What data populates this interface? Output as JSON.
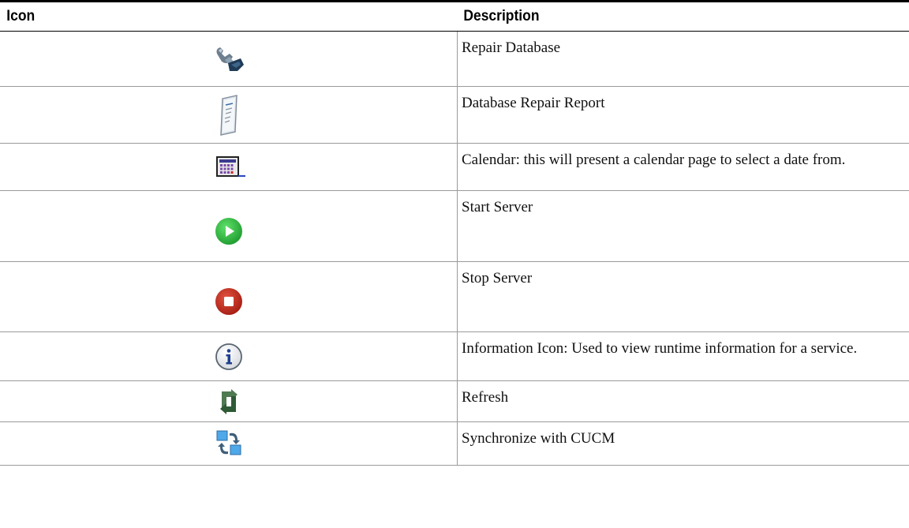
{
  "table": {
    "header": {
      "icon": "Icon",
      "description": "Description"
    },
    "rows": [
      {
        "icon": "repair-database-icon",
        "description": "Repair Database"
      },
      {
        "icon": "database-repair-report-icon",
        "description": "Database Repair Report"
      },
      {
        "icon": "calendar-icon",
        "description": "Calendar: this will present a calendar page to select a date from."
      },
      {
        "icon": "start-server-icon",
        "description": "Start Server"
      },
      {
        "icon": "stop-server-icon",
        "description": "Stop Server"
      },
      {
        "icon": "information-icon",
        "description": "Information Icon: Used to view runtime information for a service."
      },
      {
        "icon": "refresh-icon",
        "description": "Refresh"
      },
      {
        "icon": "synchronize-icon",
        "description": "Synchronize with CUCM"
      }
    ]
  }
}
